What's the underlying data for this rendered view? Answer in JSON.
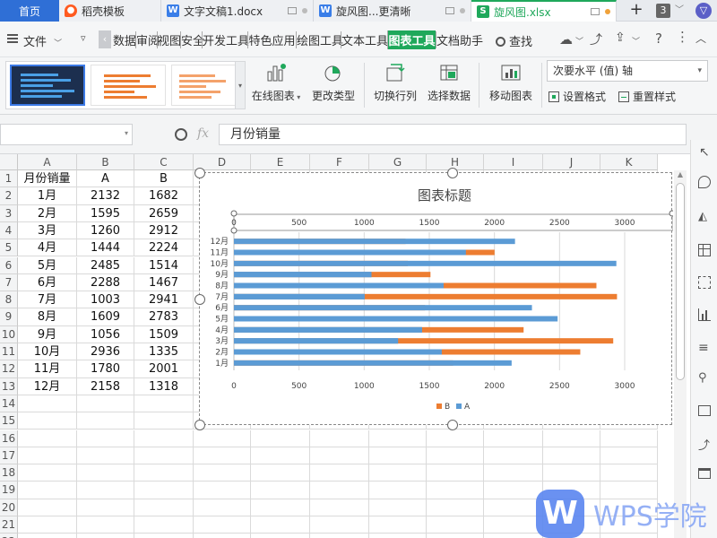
{
  "tabs": [
    {
      "label": "首页",
      "icon": "",
      "active": false
    },
    {
      "label": "稻壳模板",
      "icon": "daoke-icon"
    },
    {
      "label": "文字文稿1.docx",
      "icon": "word-doc-icon"
    },
    {
      "label": "旋风图...更清晰",
      "icon": "word-doc-icon"
    },
    {
      "label": "旋风图.xlsx",
      "icon": "excel-sheet-icon",
      "active": true
    }
  ],
  "tabbar": {
    "new_tab": "+",
    "count": "3"
  },
  "menu": {
    "file": "文件",
    "items": [
      "数据",
      "审阅",
      "视图",
      "安全",
      "开发工具",
      "特色应用",
      "绘图工具",
      "文本工具",
      "图表工具",
      "文档助手"
    ],
    "active": "图表工具",
    "search": "查找"
  },
  "ribbon": {
    "online_chart": "在线图表",
    "change_type": "更改类型",
    "switch_row_col": "切换行列",
    "select_data": "选择数据",
    "move_chart": "移动图表",
    "element_select": "次要水平 (值) 轴",
    "set_format": "设置格式",
    "reset_style": "重置样式"
  },
  "formula": {
    "name_box": "",
    "fx": "fx",
    "content": "月份销量"
  },
  "sheet": {
    "columns": [
      "A",
      "B",
      "C",
      "D",
      "E",
      "F",
      "G",
      "H",
      "I",
      "J",
      "K"
    ],
    "rows": [
      [
        "月份销量",
        "A",
        "B"
      ],
      [
        "1月",
        "2132",
        "1682"
      ],
      [
        "2月",
        "1595",
        "2659"
      ],
      [
        "3月",
        "1260",
        "2912"
      ],
      [
        "4月",
        "1444",
        "2224"
      ],
      [
        "5月",
        "2485",
        "1514"
      ],
      [
        "6月",
        "2288",
        "1467"
      ],
      [
        "7月",
        "1003",
        "2941"
      ],
      [
        "8月",
        "1609",
        "2783"
      ],
      [
        "9月",
        "1056",
        "1509"
      ],
      [
        "10月",
        "2936",
        "1335"
      ],
      [
        "11月",
        "1780",
        "2001"
      ],
      [
        "12月",
        "2158",
        "1318"
      ]
    ],
    "row_numbers": [
      "1",
      "2",
      "3",
      "4",
      "5",
      "6",
      "7",
      "8",
      "9",
      "10",
      "11",
      "12",
      "13",
      "14",
      "15",
      "16",
      "17",
      "18",
      "19",
      "20",
      "21",
      "22"
    ]
  },
  "chart_data": {
    "type": "bar",
    "orientation": "horizontal",
    "stacked": false,
    "title": "图表标题",
    "categories": [
      "1月",
      "2月",
      "3月",
      "4月",
      "5月",
      "6月",
      "7月",
      "8月",
      "9月",
      "10月",
      "11月",
      "12月"
    ],
    "series": [
      {
        "name": "A",
        "color": "#5b9bd5",
        "axis": "primary",
        "values": [
          2132,
          1595,
          1260,
          1444,
          2485,
          2288,
          1003,
          1609,
          1056,
          2936,
          1780,
          2158
        ]
      },
      {
        "name": "B",
        "color": "#ed7d31",
        "axis": "secondary",
        "values": [
          1682,
          2659,
          2912,
          2224,
          1514,
          1467,
          2941,
          2783,
          1509,
          1335,
          2001,
          1318
        ]
      }
    ],
    "xlim": [
      0,
      3000
    ],
    "ticks": [
      "0",
      "500",
      "1000",
      "1500",
      "2000",
      "2500",
      "3000"
    ],
    "legend": {
      "position": "bottom",
      "entries": [
        "B",
        "A"
      ]
    }
  },
  "watermark": {
    "text": "WPS学院"
  }
}
